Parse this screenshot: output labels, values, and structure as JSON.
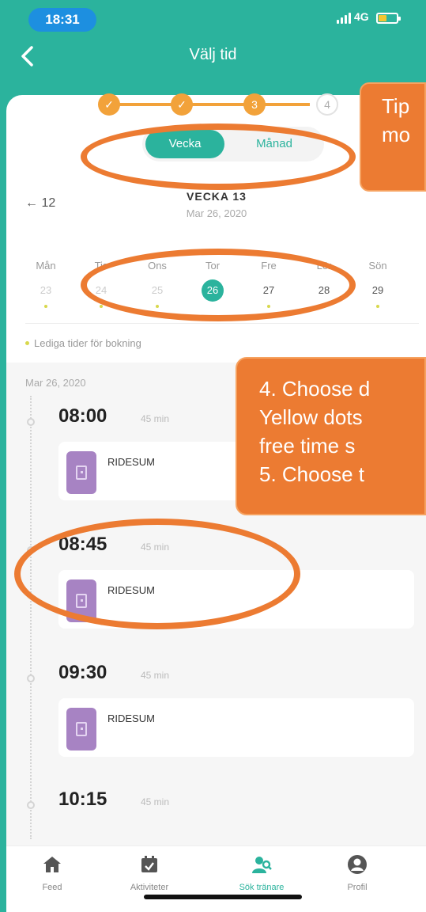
{
  "status_bar": {
    "time": "18:31",
    "network": "4G",
    "battery_color": "#f3c630"
  },
  "nav": {
    "title": "Välj tid",
    "back_icon": "back-chevron-icon"
  },
  "steps": [
    {
      "label": "",
      "state": "done"
    },
    {
      "label": "",
      "state": "done"
    },
    {
      "label": "3",
      "state": "done"
    },
    {
      "label": "4",
      "state": "current"
    }
  ],
  "view_toggle": {
    "week": "Vecka",
    "month": "Månad",
    "selected": "Vecka"
  },
  "week_header": {
    "prev": "← 12",
    "title": "VECKA 13",
    "date": "Mar 26, 2020"
  },
  "days": [
    {
      "name": "Mån",
      "num": "23",
      "available": true,
      "faded": true
    },
    {
      "name": "Tis",
      "num": "24",
      "available": true,
      "faded": true
    },
    {
      "name": "Ons",
      "num": "25",
      "available": true,
      "faded": true
    },
    {
      "name": "Tor",
      "num": "26",
      "available": false,
      "selected": true
    },
    {
      "name": "Fre",
      "num": "27",
      "available": true
    },
    {
      "name": "Lör",
      "num": "28",
      "available": true
    },
    {
      "name": "Sön",
      "num": "29",
      "available": true
    }
  ],
  "legend": "Lediga tider för bokning",
  "list_date": "Mar 26, 2020",
  "slots": [
    {
      "time": "08:00",
      "duration": "45 min",
      "name": "RIDESUM"
    },
    {
      "time": "08:45",
      "duration": "45 min",
      "name": "RIDESUM"
    },
    {
      "time": "09:30",
      "duration": "45 min",
      "name": "RIDESUM"
    },
    {
      "time": "10:15",
      "duration": "45 min",
      "name": ""
    }
  ],
  "bottom_nav": [
    {
      "label": "Feed",
      "icon": "home-icon",
      "active": false
    },
    {
      "label": "Aktiviteter",
      "icon": "calendar-check-icon",
      "active": false
    },
    {
      "label": "Sök tränare",
      "icon": "find-trainer-icon",
      "active": true
    },
    {
      "label": "Profil",
      "icon": "profile-icon",
      "active": false
    }
  ],
  "annotations": {
    "callout_1": [
      "Tip",
      "mo"
    ],
    "callout_2": [
      "4. Choose d",
      "Yellow dots",
      "free time s",
      "5. Choose t"
    ]
  },
  "colors": {
    "accent": "#2bb39d",
    "callout": "#ec7b32",
    "dot": "#d8d84c",
    "thumb": "#a783c3"
  }
}
